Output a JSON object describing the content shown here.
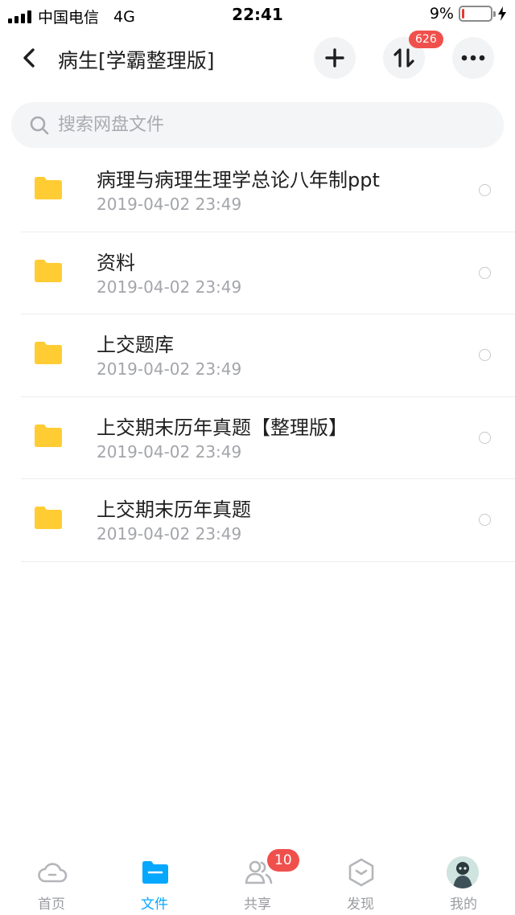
{
  "status_bar": {
    "carrier": "中国电信",
    "network": "4G",
    "time": "22:41",
    "battery_percent": "9%",
    "battery_level": 0.09,
    "battery_color": "#e53935"
  },
  "header": {
    "title": "病生[学霸整理版]",
    "back_icon": "chevron-left-icon",
    "add_icon": "plus-icon",
    "transfer_icon": "transfer-arrows-icon",
    "transfer_badge": "626",
    "more_icon": "ellipsis-icon"
  },
  "search": {
    "placeholder": "搜索网盘文件",
    "value": ""
  },
  "files": [
    {
      "name": "病理与病理生理学总论八年制ppt",
      "date": "2019-04-02 23:49",
      "icon": "folder-icon"
    },
    {
      "name": "资料",
      "date": "2019-04-02 23:49",
      "icon": "folder-icon"
    },
    {
      "name": "上交题库",
      "date": "2019-04-02 23:49",
      "icon": "folder-icon"
    },
    {
      "name": "上交期末历年真题【整理版】",
      "date": "2019-04-02 23:49",
      "icon": "folder-icon"
    },
    {
      "name": "上交期末历年真题",
      "date": "2019-04-02 23:49",
      "icon": "folder-icon"
    }
  ],
  "tabbar": {
    "tabs": [
      {
        "label": "首页",
        "icon": "cloud-home-icon",
        "active": false
      },
      {
        "label": "文件",
        "icon": "folder-icon",
        "active": true
      },
      {
        "label": "共享",
        "icon": "users-icon",
        "active": false,
        "badge": "10"
      },
      {
        "label": "发现",
        "icon": "discover-icon",
        "active": false
      },
      {
        "label": "我的",
        "icon": "avatar",
        "active": false
      }
    ]
  },
  "colors": {
    "accent": "#06a7ff",
    "folder": "#ffcc33",
    "badge": "#f0504c",
    "inactive": "#9a9ca1"
  }
}
